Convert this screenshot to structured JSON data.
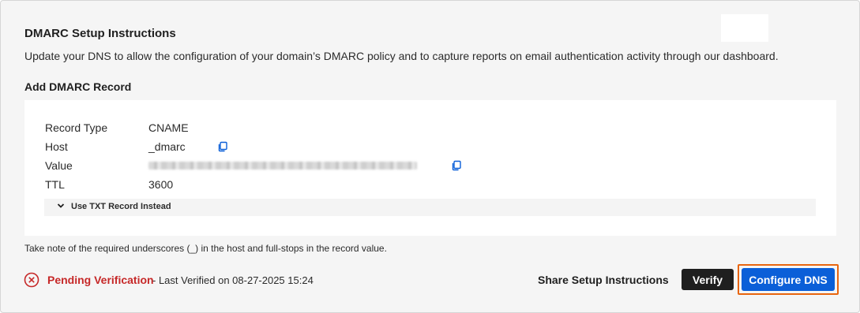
{
  "header": {
    "title": "DMARC Setup Instructions",
    "description": "Update your DNS to allow the configuration of your domain’s DMARC policy and to capture reports on email authentication activity through our dashboard."
  },
  "record": {
    "heading": "Add DMARC Record",
    "rows": [
      {
        "label": "Record Type",
        "value": "CNAME"
      },
      {
        "label": "Host",
        "value": "_dmarc"
      },
      {
        "label": "Value",
        "value": ""
      },
      {
        "label": "TTL",
        "value": "3600"
      }
    ],
    "txt_toggle_label": "Use TXT Record Instead"
  },
  "note": "Take note of the required underscores (_) in the host and full-stops in the record value.",
  "status": {
    "label": "Pending Verification",
    "last_verified": "- Last Verified on 08-27-2025 15:24",
    "color": "#c62828"
  },
  "actions": {
    "share_label": "Share Setup Instructions",
    "verify_label": "Verify",
    "configure_label": "Configure DNS"
  },
  "colors": {
    "primary": "#0b5fd8",
    "highlight": "#e8650f",
    "dark_button": "#1f1f1f"
  },
  "icons": {
    "copy": "copy-icon",
    "chevron": "chevron-down-icon",
    "error": "x-circle-icon"
  }
}
